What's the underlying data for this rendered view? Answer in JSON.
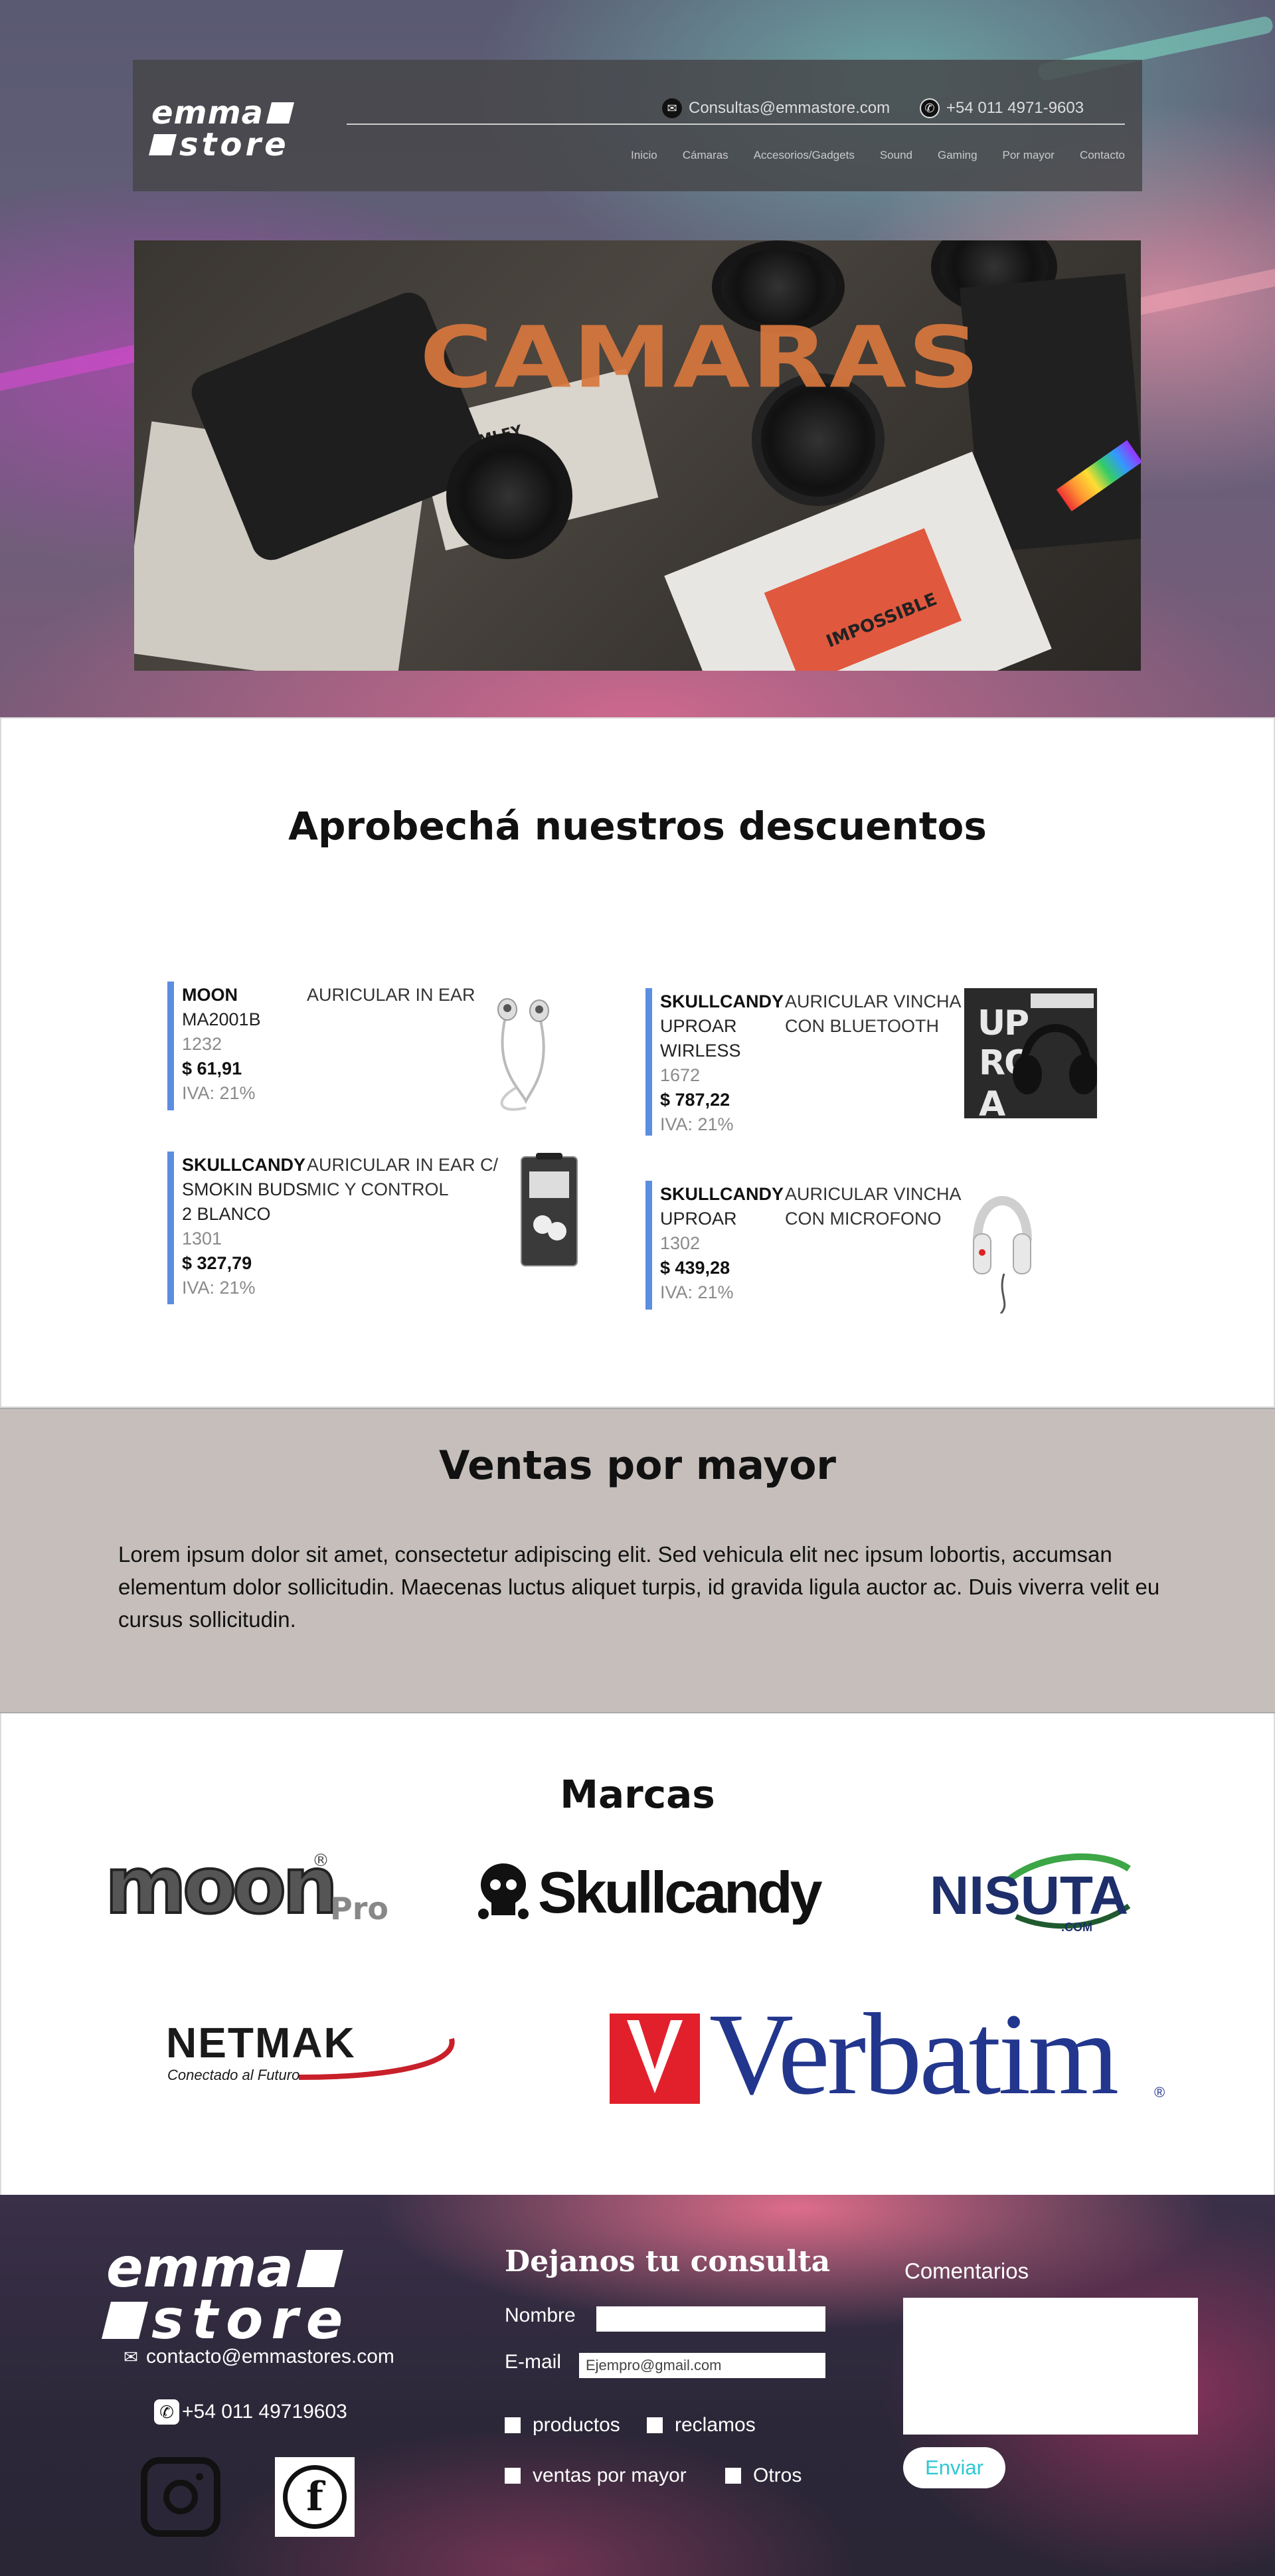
{
  "header": {
    "logo_line1": "emma",
    "logo_line2": "store",
    "email": "Consultas@emmastore.com",
    "phone": "+54 011 4971-9603",
    "nav": [
      "Inicio",
      "Cámaras",
      "Accesorios/Gadgets",
      "Sound",
      "Gaming",
      "Por mayor",
      "Contacto"
    ]
  },
  "banner": {
    "title": "CAMARAS",
    "card_text_1": "PLOMLEY",
    "card_text_2": "IMPOSSIBLE"
  },
  "discounts": {
    "title": "Aprobechá nuestros descuentos",
    "products": [
      {
        "brand": "MOON",
        "model": "MA2001B",
        "code": "1232",
        "price": "$ 61,91",
        "iva": "IVA: 21%",
        "desc": "AURICULAR IN EAR",
        "image": "in-ear-earphones"
      },
      {
        "brand": "SKULLCANDY",
        "model": "UPROAR WIRLESS",
        "code": "1672",
        "price": "$ 787,22",
        "iva": "IVA: 21%",
        "desc": "AURICULAR VINCHA CON BLUETOOTH",
        "image": "uproar-headphones-box"
      },
      {
        "brand": "SKULLCANDY",
        "model": "SMOKIN BUDS 2 BLANCO",
        "code": "1301",
        "price": "$ 327,79",
        "iva": "IVA: 21%",
        "desc": "AURICULAR IN EAR C/ MIC Y CONTROL",
        "image": "smokin-buds-package"
      },
      {
        "brand": "SKULLCANDY",
        "model": "UPROAR",
        "code": "1302",
        "price": "$ 439,28",
        "iva": "IVA: 21%",
        "desc": "AURICULAR VINCHA CON MICROFONO",
        "image": "white-headphones"
      }
    ]
  },
  "wholesale": {
    "title": "Ventas por mayor",
    "text": "Lorem ipsum dolor sit amet, consectetur adipiscing elit. Sed vehicula elit nec ipsum lobortis, accumsan elementum dolor sollicitudin. Maecenas luctus aliquet turpis, id gravida ligula auctor ac. Duis viverra velit eu cursus sollicitudin."
  },
  "brands": {
    "title": "Marcas",
    "logos": {
      "moon": "moon",
      "moon_pro": "Pro",
      "moon_reg": "®",
      "skullcandy": "Skullcandy",
      "nisuta": "NISUTA",
      "nisuta_com": ".COM",
      "netmak": "NETMAK",
      "netmak_tagline": "Conectado al Futuro",
      "verbatim": "Verbatim",
      "verbatim_reg": "®"
    }
  },
  "footer": {
    "logo_line1": "emma",
    "logo_line2": "store",
    "email": "contacto@emmastores.com",
    "phone": "+54 011 49719603",
    "form_title": "Dejanos tu consulta",
    "name_label": "Nombre",
    "email_label": "E-mail",
    "email_placeholder": "Ejempro@gmail.com",
    "checkboxes": [
      "productos",
      "reclamos",
      "ventas por mayor",
      "Otros"
    ],
    "comments_label": "Comentarios",
    "send_label": "Enviar"
  },
  "colors": {
    "accent_bar": "#5b8ee0",
    "wholesale_bg": "#c5bebb",
    "send_text": "#2ec8d2"
  }
}
